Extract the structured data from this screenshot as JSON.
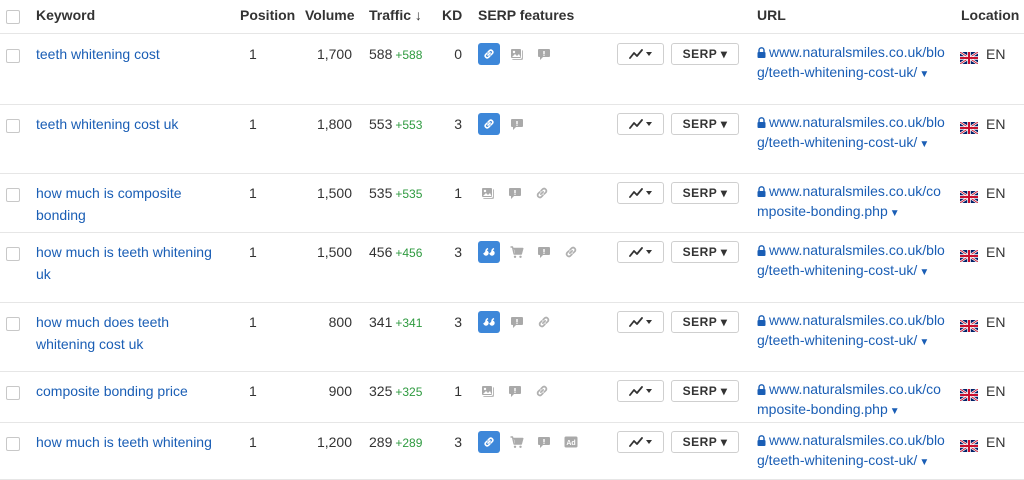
{
  "header": {
    "keyword": "Keyword",
    "position": "Position",
    "volume": "Volume",
    "traffic": "Traffic ↓",
    "kd": "KD",
    "serp_features": "SERP features",
    "url": "URL",
    "location": "Location"
  },
  "buttons": {
    "serp_label": "SERP ▾"
  },
  "rows": [
    {
      "keyword": "teeth whitening cost",
      "position": "1",
      "volume": "1,700",
      "traffic": "588",
      "delta": "+588",
      "kd": "0",
      "features": [
        "link-blue",
        "image-grey",
        "chat-grey"
      ],
      "url": "www.naturalsmiles.co.uk/blog/teeth-whitening-cost-uk/",
      "location": "EN"
    },
    {
      "keyword": "teeth whitening cost uk",
      "position": "1",
      "volume": "1,800",
      "traffic": "553",
      "delta": "+553",
      "kd": "3",
      "features": [
        "link-blue",
        "chat-grey"
      ],
      "url": "www.naturalsmiles.co.uk/blog/teeth-whitening-cost-uk/",
      "location": "EN"
    },
    {
      "keyword": "how much is composite bonding",
      "position": "1",
      "volume": "1,500",
      "traffic": "535",
      "delta": "+535",
      "kd": "1",
      "features": [
        "image-grey",
        "chat-grey",
        "link-grey"
      ],
      "url": "www.naturalsmiles.co.uk/composite-bonding.php",
      "location": "EN"
    },
    {
      "keyword": "how much is teeth whitening uk",
      "position": "1",
      "volume": "1,500",
      "traffic": "456",
      "delta": "+456",
      "kd": "3",
      "features": [
        "quote-blue",
        "cart-grey",
        "chat-grey",
        "link-grey"
      ],
      "url": "www.naturalsmiles.co.uk/blog/teeth-whitening-cost-uk/",
      "location": "EN"
    },
    {
      "keyword": "how much does teeth whitening cost uk",
      "position": "1",
      "volume": "800",
      "traffic": "341",
      "delta": "+341",
      "kd": "3",
      "features": [
        "quote-blue",
        "chat-grey",
        "link-grey"
      ],
      "url": "www.naturalsmiles.co.uk/blog/teeth-whitening-cost-uk/",
      "location": "EN"
    },
    {
      "keyword": "composite bonding price",
      "position": "1",
      "volume": "900",
      "traffic": "325",
      "delta": "+325",
      "kd": "1",
      "features": [
        "image-grey",
        "chat-grey",
        "link-grey"
      ],
      "url": "www.naturalsmiles.co.uk/composite-bonding.php",
      "location": "EN"
    },
    {
      "keyword": "how much is teeth whitening",
      "position": "1",
      "volume": "1,200",
      "traffic": "289",
      "delta": "+289",
      "kd": "3",
      "features": [
        "link-blue",
        "cart-grey",
        "chat-grey",
        "ad-grey"
      ],
      "url": "www.naturalsmiles.co.uk/blog/teeth-whitening-cost-uk/",
      "location": "EN"
    }
  ],
  "colors": {
    "link": "#1a5eb5",
    "positive": "#2e9a3f",
    "feature_blue": "#3d87d9",
    "feature_grey": "#a9a9a9"
  }
}
